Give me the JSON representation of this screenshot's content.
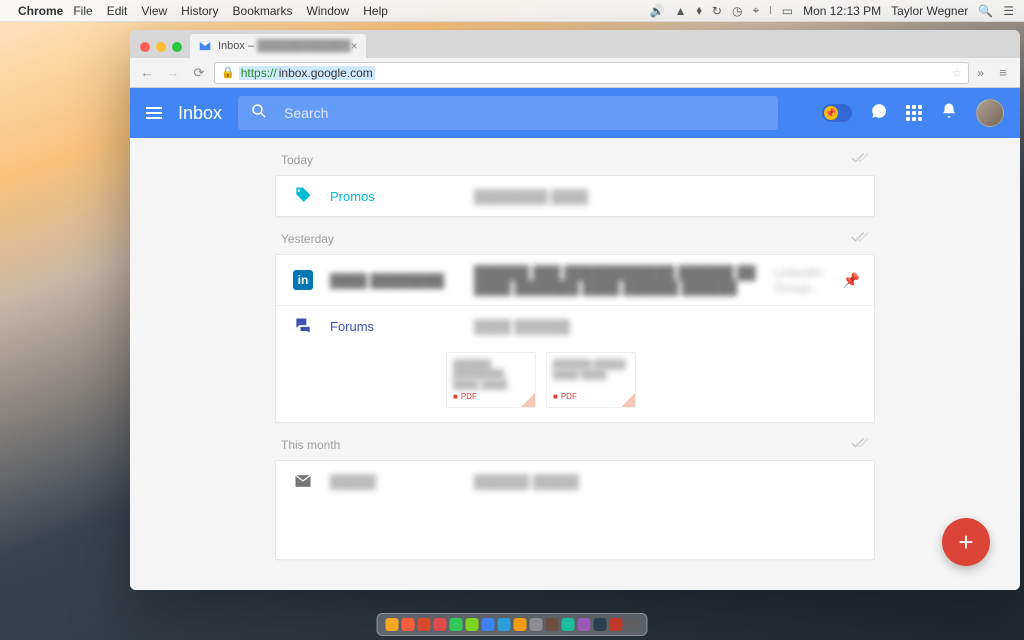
{
  "menubar": {
    "app": "Chrome",
    "items": [
      "File",
      "Edit",
      "View",
      "History",
      "Bookmarks",
      "Window",
      "Help"
    ],
    "clock": "Mon 12:13 PM",
    "user": "Taylor Wegner"
  },
  "browser": {
    "tab_title": "Inbox –",
    "https": "https://",
    "url": "inbox.google.com"
  },
  "appbar": {
    "title": "Inbox",
    "search_placeholder": "Search"
  },
  "sections": {
    "today": "Today",
    "yesterday": "Yesterday",
    "this_month": "This month"
  },
  "bundles": {
    "promos": "Promos",
    "forums": "Forums"
  },
  "redacted": {
    "promos_preview": "████████ ████",
    "linkedin_sender": "████ ████████",
    "linkedin_subject": "██████ ███ ████████████ ██████ ██ ████ ███████ ████ ██████ ██████",
    "linkedin_source": "LinkedIn Group…",
    "forums_preview": "████ ██████",
    "month_sender": "█████",
    "month_preview": "██████ █████",
    "tab_suffix": "████████████"
  },
  "attachments": {
    "a1_line1": "██████ ████████",
    "a1_line2": "████-████…",
    "a2_line1": "██████ █████",
    "a2_line2": "████ ████",
    "pdf": "PDF"
  },
  "dock_colors": [
    "#f5a623",
    "#ff5e3a",
    "#d94a2b",
    "#e14b4b",
    "#34c759",
    "#7ed321",
    "#3b82f6",
    "#2d9cdb",
    "#f39c12",
    "#8e8e93",
    "#6d4c41",
    "#1abc9c",
    "#9b59b6",
    "#2c3e50",
    "#c0392b",
    "#606060"
  ]
}
